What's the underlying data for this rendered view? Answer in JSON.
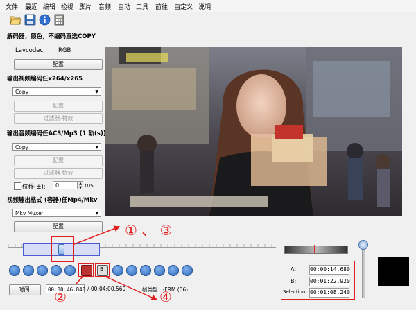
{
  "menu": [
    "文件",
    "最近",
    "编辑",
    "检视",
    "影片",
    "音频",
    "自动",
    "工具",
    "前往",
    "自定义",
    "说明"
  ],
  "toolbar_icons": [
    "open-folder-icon",
    "save-disk-icon",
    "info-icon",
    "calculator-icon"
  ],
  "left_panel": {
    "decoder_title": "解码器，颜色，不编码直选COPY",
    "decoder_name": "Lavcodec",
    "color_space": "RGB",
    "config1": "配置",
    "video_out_title": "输出视频编码任x264/x265",
    "video_codec": "Copy",
    "config2": "配置",
    "filters1": "过滤器-特效",
    "audio_out_title": "输出音频编码任AC3/Mp3 (1 轨(s))",
    "audio_codec": "Copy",
    "config3": "配置",
    "filters2": "过滤器-特效",
    "shift_label": "位移(±):",
    "shift_value": "0",
    "shift_unit": "ms",
    "format_title": "视频输出格式 (容器)任Mp4/Mkv",
    "muxer": "Mkv Muxer",
    "config4": "配置"
  },
  "annotations": {
    "arrow_nums_1_3": "①  、 ③",
    "num2": "②",
    "num4": "④"
  },
  "status": {
    "time_button": "时间:",
    "current_time": "00:00:46.840",
    "total_time": "/ 00:04:00.560",
    "frame_type": "帧类型:  I-FRM (06)"
  },
  "ab": {
    "a_label": "A:",
    "a_value": "00:00:14.680",
    "b_label": "B:",
    "b_value": "00:01:22.920",
    "sel_label": "Selection:",
    "sel_value": "00:01:08.240"
  },
  "playback_buttons": [
    "play",
    "rewind",
    "prev-frame",
    "prev-keyframe",
    "next-keyframe",
    "set-a",
    "set-b",
    "prev-black",
    "stop",
    "next-black",
    "prev-edit",
    "next-edit",
    "first-frame",
    "last-frame"
  ],
  "colors": {
    "annotation_red": "#e02020",
    "accent_blue": "#2c64b8"
  }
}
